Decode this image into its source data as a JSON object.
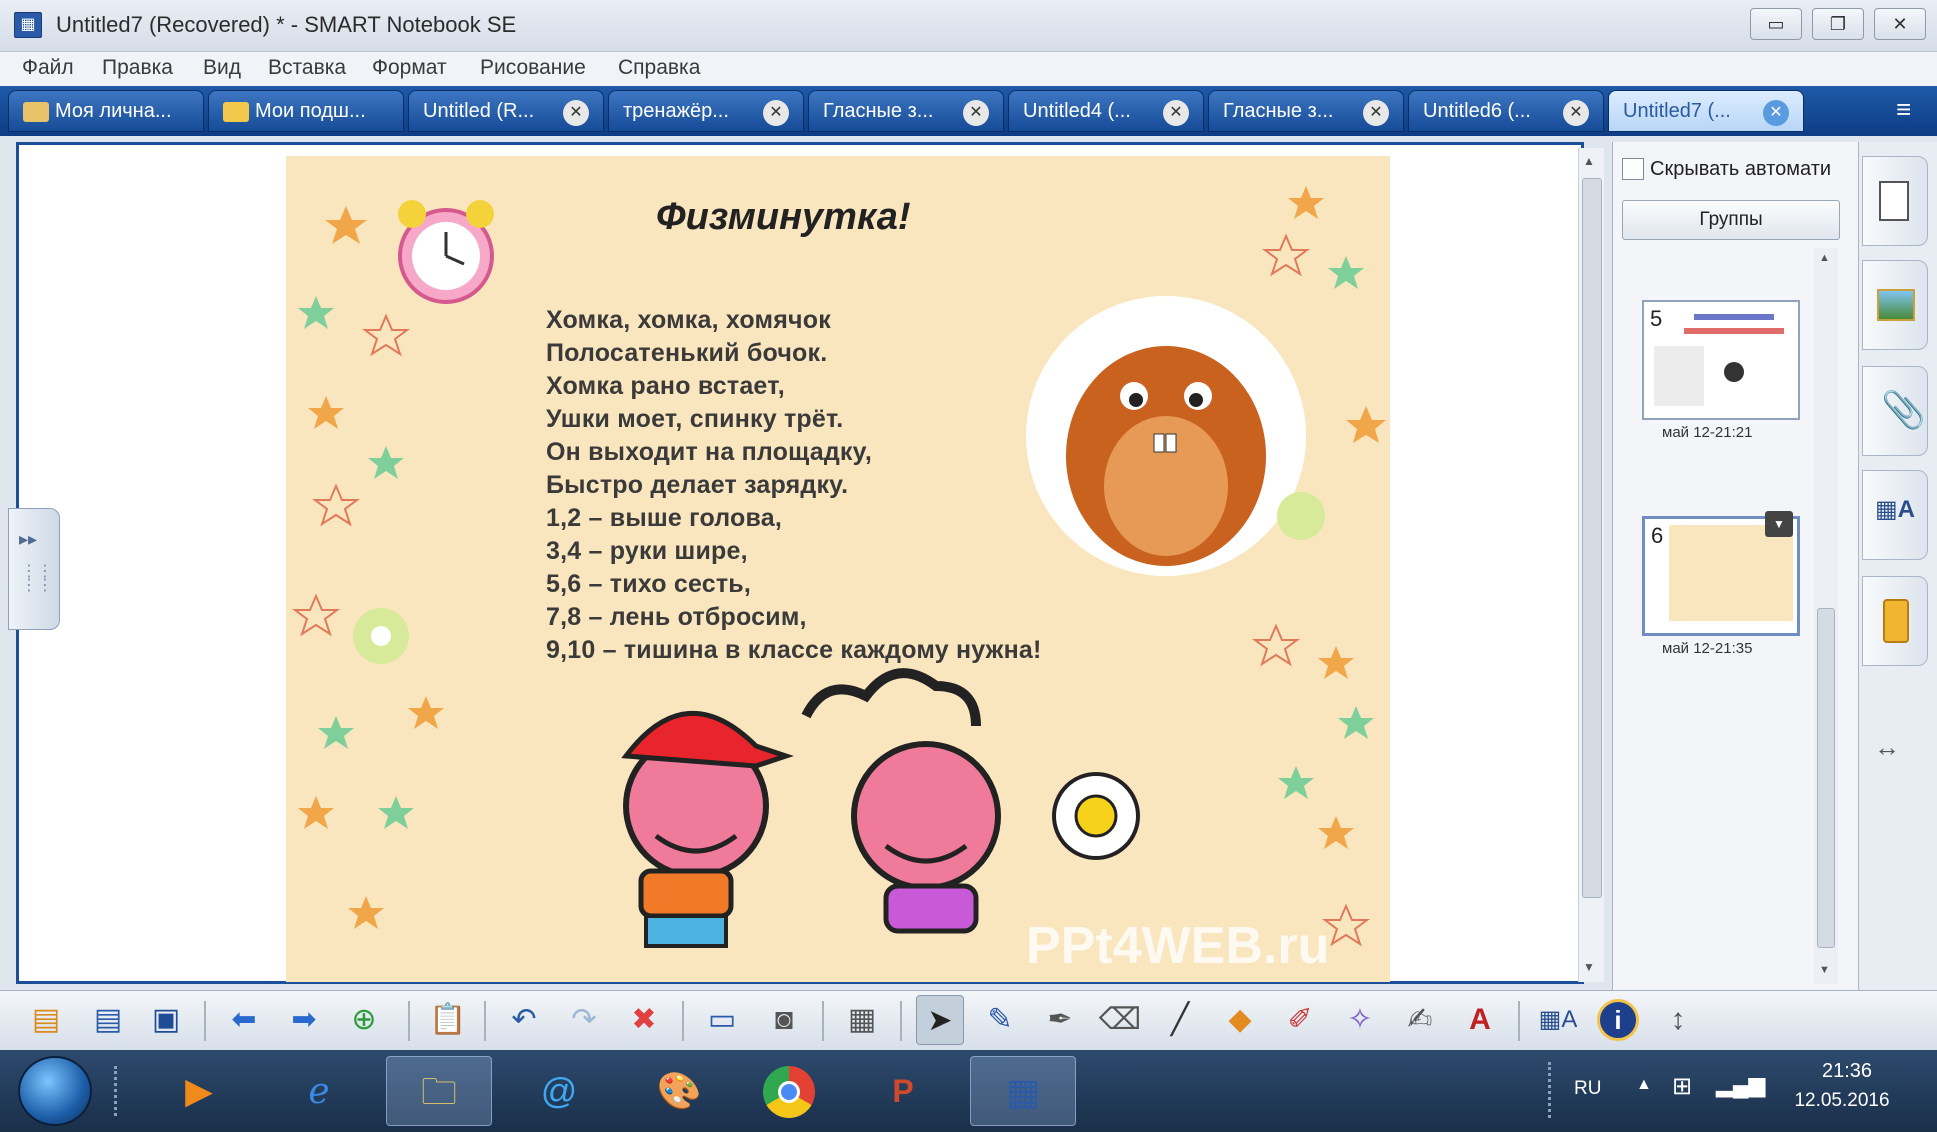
{
  "window": {
    "title": "Untitled7 (Recovered) * - SMART Notebook SE",
    "min_glyph": "▭",
    "restore_glyph": "❐",
    "close_glyph": "✕"
  },
  "menu": [
    "Файл",
    "Правка",
    "Вид",
    "Вставка",
    "Формат",
    "Рисование",
    "Справка"
  ],
  "tabs": [
    {
      "label": "Моя лична..."
    },
    {
      "label": "Мои подш..."
    },
    {
      "label": "Untitled (R..."
    },
    {
      "label": "тренажёр..."
    },
    {
      "label": "Гласные з..."
    },
    {
      "label": "Untitled4 (..."
    },
    {
      "label": "Гласные з..."
    },
    {
      "label": "Untitled6 (..."
    },
    {
      "label": "Untitled7 (..."
    }
  ],
  "slide": {
    "title": "Физминутка!",
    "poem": [
      "Хомка, хомка, хомячок",
      "Полосатенький бочок.",
      "Хомка рано встает,",
      "Ушки моет, спинку трёт.",
      "Он выходит на площадку,",
      "Быстро делает зарядку.",
      "1,2 – выше голова,",
      "3,4 – руки шире,",
      "5,6 – тихо сесть,",
      "7,8 – лень отбросим,",
      "9,10 – тишина в классе каждому нужна!"
    ],
    "watermark": "PPt4WEB.ru"
  },
  "page_sorter": {
    "autohide_label": "Скрывать автомати",
    "groups_button": "Группы",
    "pages": [
      {
        "number": "5",
        "date": "май 12-21:21"
      },
      {
        "number": "6",
        "date": "май 12-21:35"
      }
    ]
  },
  "toolbar": {
    "tools": [
      "new-page",
      "page",
      "save",
      "back",
      "forward",
      "add-page",
      "paste",
      "undo",
      "redo",
      "delete",
      "screen-shade",
      "capture",
      "table",
      "select",
      "pen",
      "creative-pen",
      "eraser",
      "line",
      "shapes",
      "fill",
      "magic-pen",
      "text-tool",
      "text",
      "properties",
      "info",
      "move-toolbar"
    ]
  },
  "taskbar": {
    "lang": "RU",
    "time": "21:36",
    "date": "12.05.2016"
  },
  "colors": {
    "accent": "#1c4f9a",
    "slide_bg": "#fae6be",
    "tab_active": "#b9d6f6"
  }
}
